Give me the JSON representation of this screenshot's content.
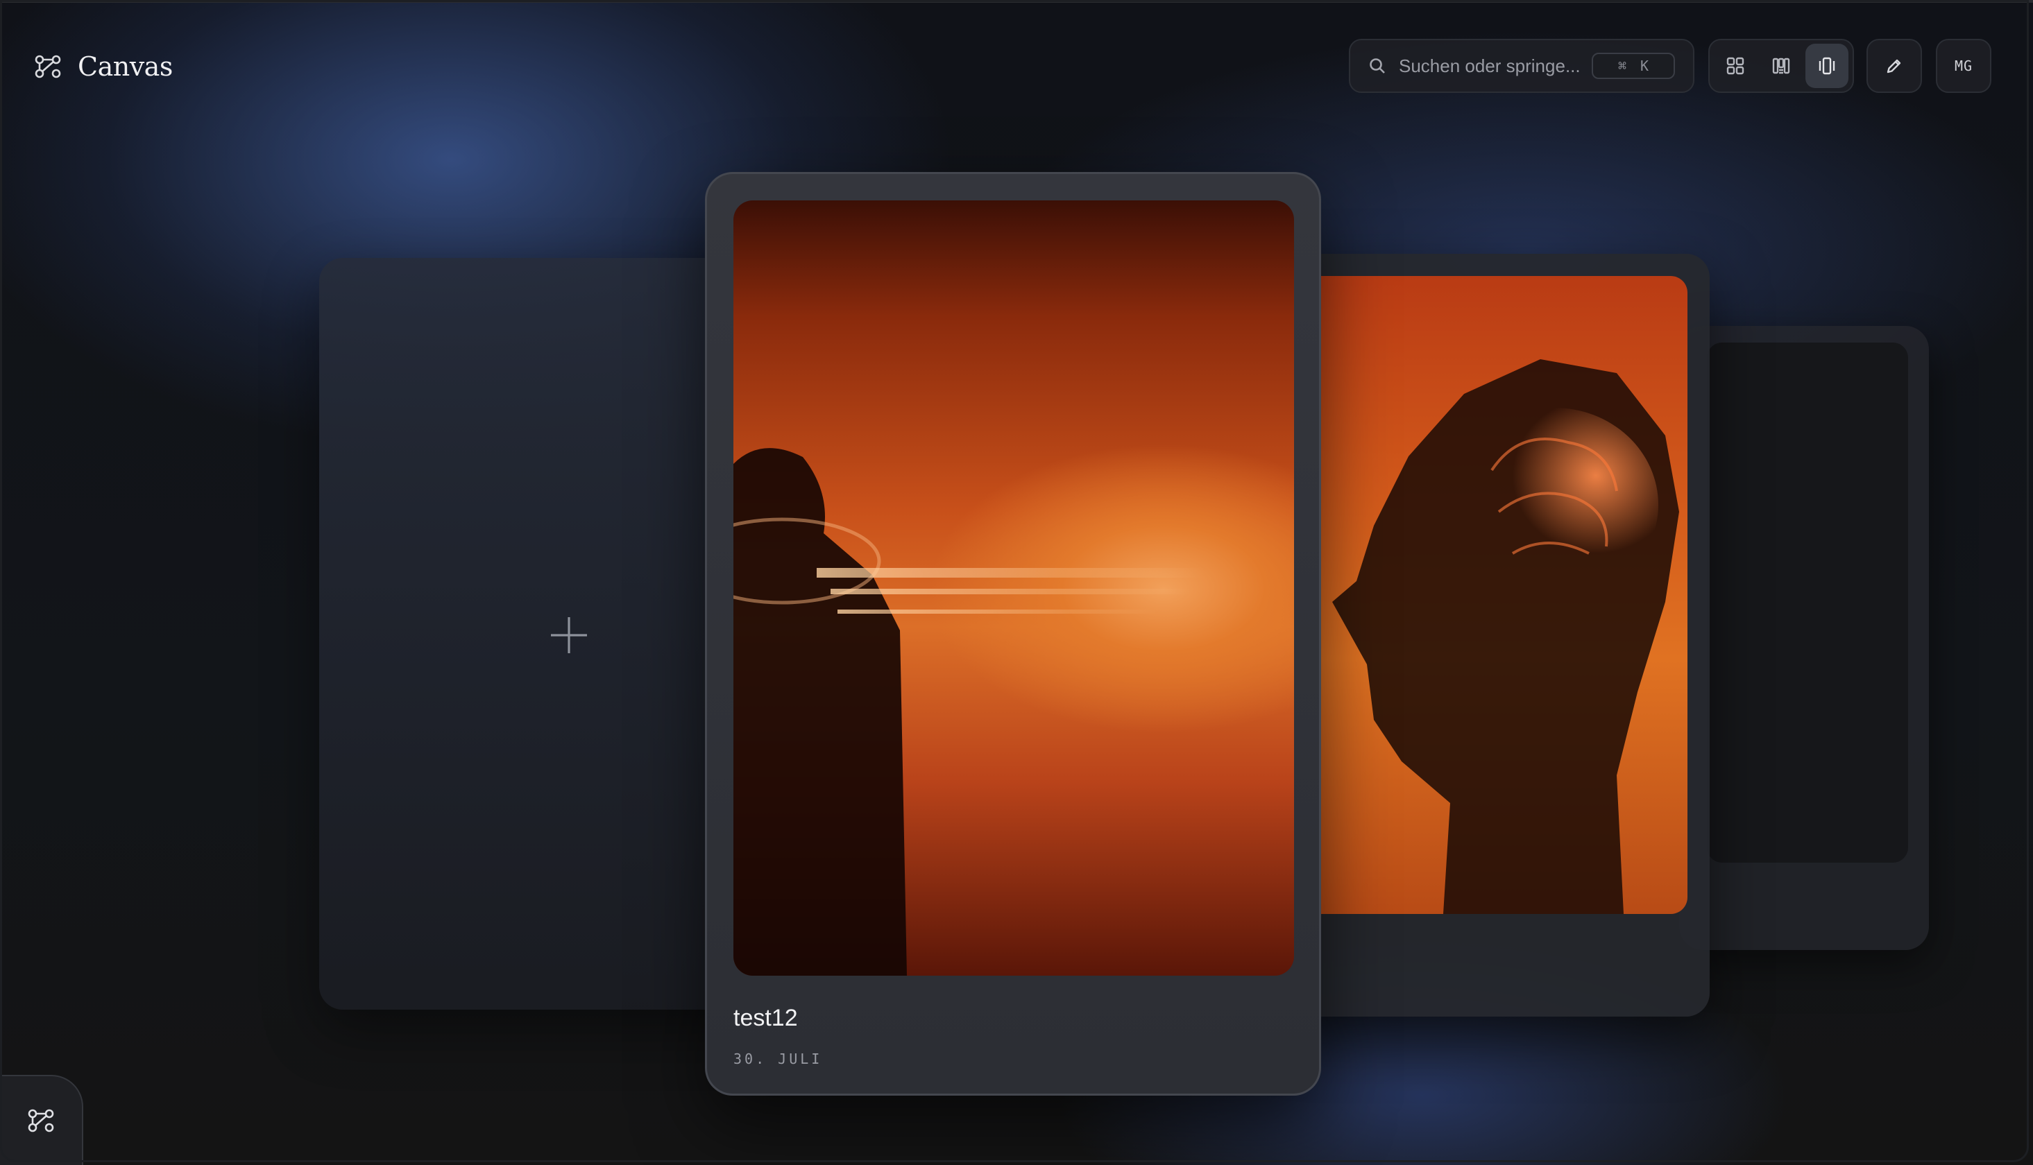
{
  "app": {
    "title": "Canvas",
    "logo_icon": "graph-nodes-icon"
  },
  "search": {
    "placeholder": "Suchen oder springe...",
    "shortcut_symbol": "⌘",
    "shortcut_key": "K"
  },
  "views": [
    {
      "name": "grid-view",
      "icon": "grid-icon",
      "active": false
    },
    {
      "name": "columns-view",
      "icon": "columns-icon",
      "active": false
    },
    {
      "name": "carousel-view",
      "icon": "carousel-icon",
      "active": true
    }
  ],
  "edit": {
    "icon": "pencil-icon"
  },
  "user": {
    "initials": "MG"
  },
  "cards": {
    "add": {
      "icon": "plus-icon"
    },
    "featured": {
      "title": "test12",
      "date": "30. JULI"
    }
  },
  "dock": {
    "icon": "graph-nodes-icon"
  },
  "colors": {
    "accent_blue": "#3c5a9e",
    "card_bg": "#2f3137",
    "warm_orange": "#dc6f28"
  }
}
